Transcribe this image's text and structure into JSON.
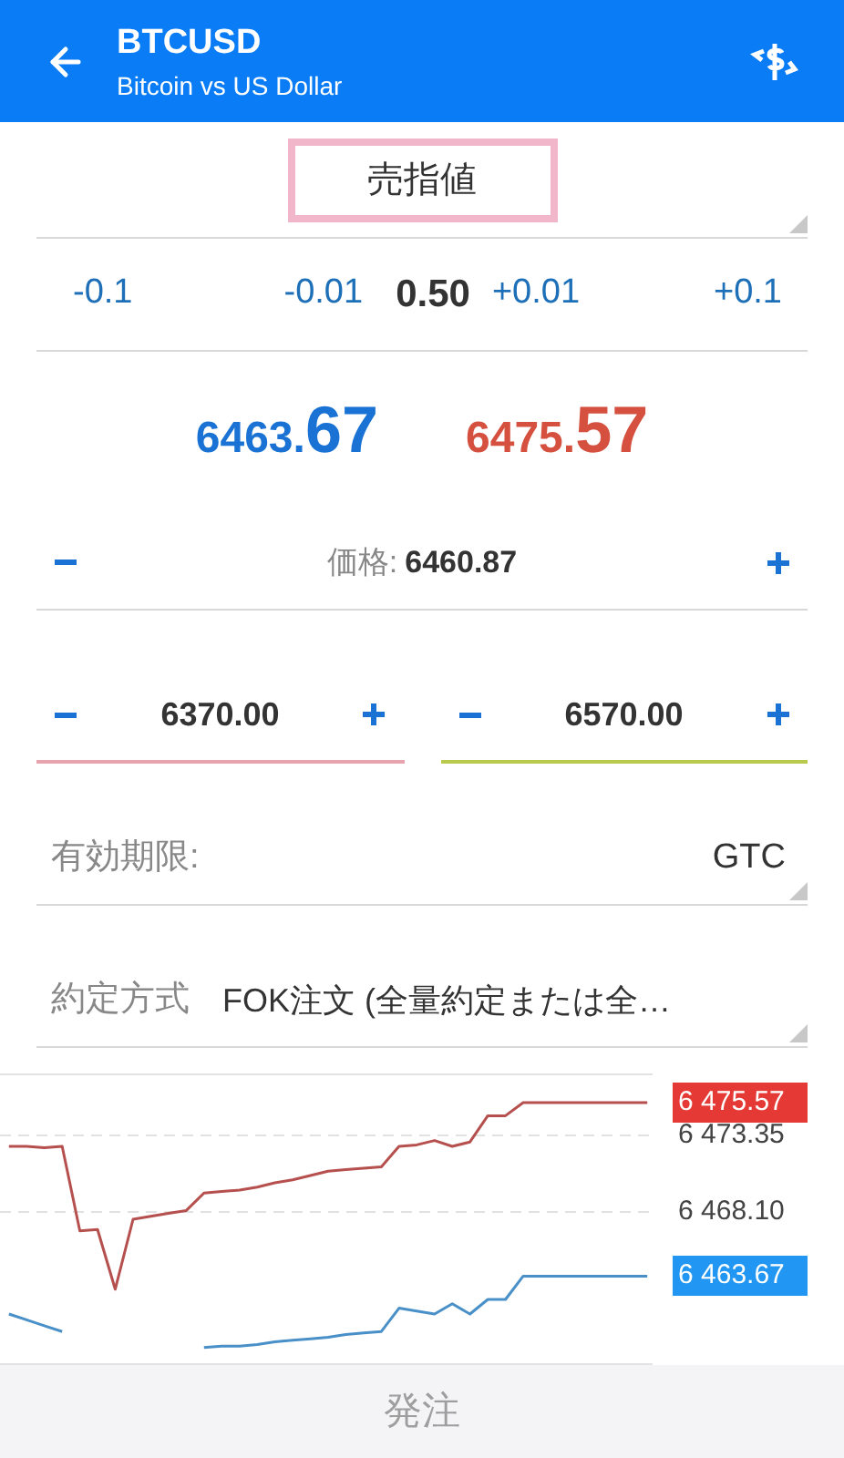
{
  "header": {
    "symbol": "BTCUSD",
    "description": "Bitcoin vs US Dollar"
  },
  "order_type": {
    "value": "売指値",
    "highlighted": true
  },
  "volume": {
    "decrease_steps": [
      "-0.1",
      "-0.01"
    ],
    "value": "0.50",
    "increase_steps": [
      "+0.01",
      "+0.1"
    ]
  },
  "quotes": [
    {
      "main": "6463.",
      "big": "67",
      "color": "#1a73d4"
    },
    {
      "main": "6475.",
      "big": "57",
      "color": "#d5503f"
    }
  ],
  "price": {
    "label": "価格:",
    "value": "6460.87"
  },
  "stops": [
    {
      "value": "6370.00",
      "color": "#e8a4ae"
    },
    {
      "value": "6570.00",
      "color": "#b9c94e"
    }
  ],
  "expiry": {
    "label": "有効期限:",
    "value": "GTC"
  },
  "filling": {
    "label": "約定方式",
    "value": "FOK注文 (全量約定または全…"
  },
  "chart_data": {
    "type": "line",
    "categories": [
      null,
      null,
      null,
      null,
      null,
      null,
      null,
      null,
      null,
      null,
      null,
      null,
      null,
      null,
      null,
      null,
      null,
      null,
      null,
      null,
      null,
      null,
      null,
      null,
      null,
      null,
      null,
      null,
      null,
      null,
      null,
      null,
      null,
      null,
      null,
      null,
      null
    ],
    "ylim": [
      6457.6,
      6477.6
    ],
    "yticks": [
      {
        "value": 6473.35,
        "label": "6 473.35"
      },
      {
        "value": 6468.1,
        "label": "6 468.10"
      }
    ],
    "series": [
      {
        "color": "#b5504e",
        "values": [
          6472.6,
          6472.6,
          6472.5,
          6472.6,
          6466.8,
          6466.9,
          6462.8,
          6467.6,
          6467.8,
          6468.0,
          6468.2,
          6469.4,
          6469.5,
          6469.6,
          6469.8,
          6470.1,
          6470.3,
          6470.6,
          6470.9,
          6471.0,
          6471.1,
          6471.2,
          6472.6,
          6472.7,
          6473.0,
          6472.6,
          6472.9,
          6474.7,
          6474.7,
          6475.6,
          6475.6,
          6475.6,
          6475.6,
          6475.6,
          6475.6,
          6475.6,
          6475.6
        ]
      },
      {
        "color": "#4a90c8",
        "values": [
          6461.1,
          6460.7,
          6460.3,
          6459.9,
          null,
          null,
          null,
          null,
          null,
          null,
          null,
          6458.8,
          6458.9,
          6458.9,
          6459.0,
          6459.2,
          6459.3,
          6459.4,
          6459.5,
          6459.7,
          6459.8,
          6459.9,
          6461.5,
          6461.3,
          6461.1,
          6461.8,
          6461.1,
          6462.1,
          6462.1,
          6463.7,
          6463.7,
          6463.7,
          6463.7,
          6463.7,
          6463.7,
          6463.7,
          6463.7
        ]
      }
    ]
  },
  "price_tags": [
    {
      "label": "6 475.57",
      "color": "#e53935"
    },
    {
      "label": "6 463.67",
      "color": "#2196f3"
    }
  ],
  "submit": {
    "label": "発注",
    "disabled": true
  }
}
